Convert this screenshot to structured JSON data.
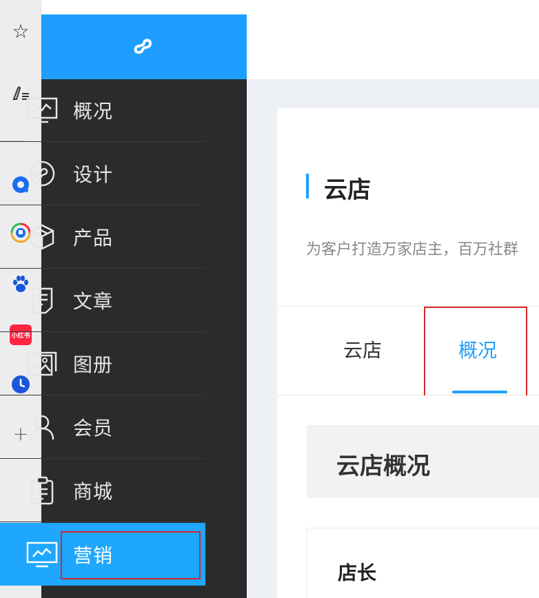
{
  "rail": {
    "items": [
      {
        "name": "star-icon",
        "glyph": "☆"
      },
      {
        "name": "note-icon",
        "glyph": "✎"
      },
      {
        "name": "qq-browser-icon"
      },
      {
        "name": "bell-icon"
      },
      {
        "name": "paw-icon"
      },
      {
        "name": "xiaohongshu-icon",
        "label": "小红书"
      },
      {
        "name": "clock-icon"
      },
      {
        "name": "add-icon",
        "glyph": "+"
      }
    ],
    "colors": {
      "blue": "#1a6cf0",
      "red": "#ff2442"
    }
  },
  "logo": {
    "icon": "mini-program-icon",
    "color": "#1e9fff"
  },
  "sidebar": {
    "items": [
      {
        "label": "概况",
        "icon": "chart-monitor-icon"
      },
      {
        "label": "设计",
        "icon": "mini-program-circle-icon"
      },
      {
        "label": "产品",
        "icon": "cube-icon"
      },
      {
        "label": "文章",
        "icon": "document-icon"
      },
      {
        "label": "图册",
        "icon": "image-gallery-icon"
      },
      {
        "label": "会员",
        "icon": "user-icon"
      },
      {
        "label": "商城",
        "icon": "clipboard-icon"
      },
      {
        "label": "营销",
        "icon": "chart-monitor-icon",
        "active": true
      }
    ],
    "active_color": "#1ea7fd",
    "bg_color": "#2b2b2b"
  },
  "page": {
    "title": "云店",
    "description": "为客户打造万家店主，百万社群"
  },
  "tabs": [
    {
      "label": "云店",
      "active": false
    },
    {
      "label": "概况",
      "active": true
    }
  ],
  "section": {
    "title": "云店概况",
    "sub_title": "店长"
  },
  "accent_color": "#1e9fff",
  "annotation_color": "#d9242b"
}
